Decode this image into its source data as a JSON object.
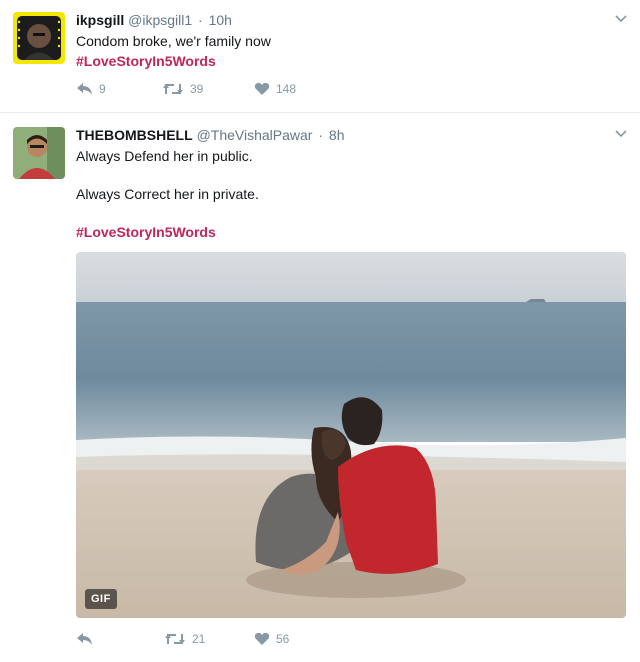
{
  "tweets": [
    {
      "name": "ikpsgill",
      "handle": "@ikpsgill1",
      "dot": "·",
      "time": "10h",
      "text_lines": [
        "Condom broke, we'r family now"
      ],
      "hashtag": "#LoveStoryIn5Words",
      "reply_count": "9",
      "retweet_count": "39",
      "like_count": "148"
    },
    {
      "name": "THEBOMBSHELL",
      "handle": "@TheVishalPawar",
      "dot": "·",
      "time": "8h",
      "text_lines": [
        "Always Defend her in public.",
        "Always Correct her in private."
      ],
      "hashtag": "#LoveStoryIn5Words",
      "media_badge": "GIF",
      "reply_count": "",
      "retweet_count": "21",
      "like_count": "56"
    }
  ],
  "icons": {
    "reply": "reply-icon",
    "retweet": "retweet-icon",
    "like": "heart-icon",
    "caret": "chevron-down-icon"
  },
  "colors": {
    "hashtag": "#c0265b",
    "meta": "#657786",
    "action": "#8899a6"
  }
}
